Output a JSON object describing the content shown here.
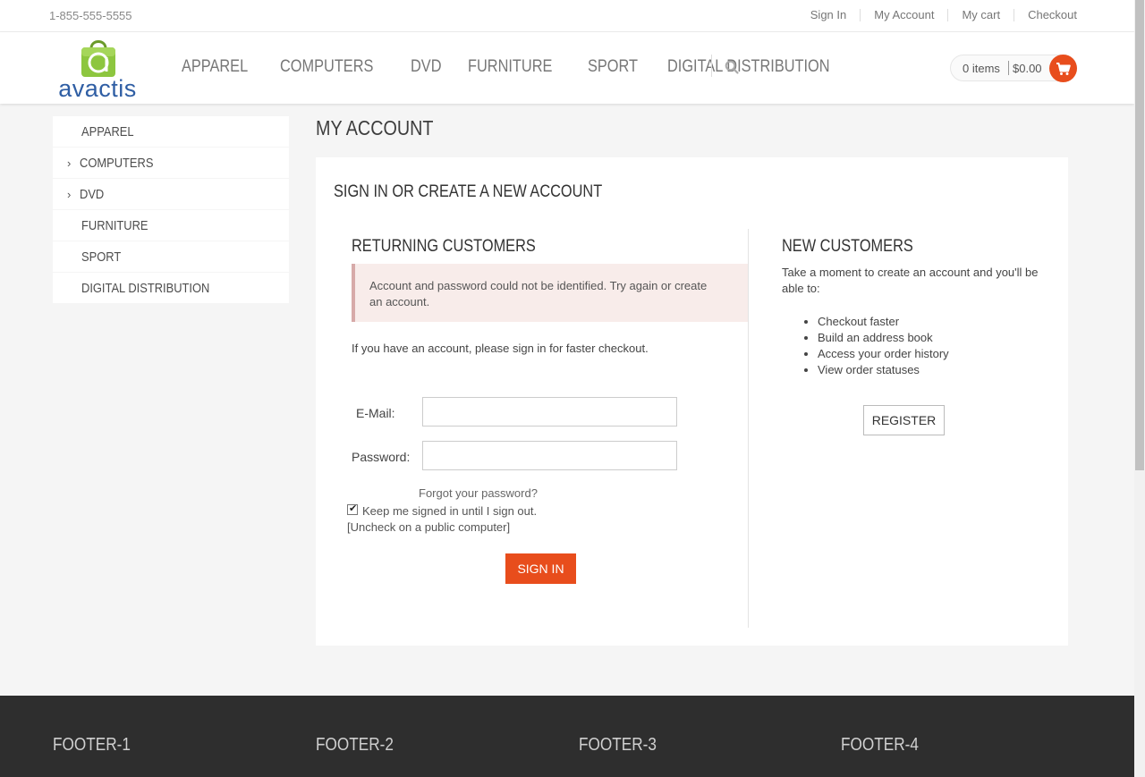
{
  "topbar": {
    "phone": "1-855-555-5555",
    "links": [
      "Sign In",
      "My Account",
      "My cart",
      "Checkout"
    ]
  },
  "header": {
    "logo_text": "avactis",
    "logo_letter": "a",
    "nav": [
      "APPAREL",
      "COMPUTERS",
      "DVD",
      "FURNITURE",
      "SPORT",
      "DIGITAL DISTRIBUTION"
    ],
    "cart": {
      "items": "0 items",
      "total": "$0.00"
    }
  },
  "sidebar": {
    "items": [
      {
        "label": "APPAREL",
        "chevron": ""
      },
      {
        "label": "COMPUTERS",
        "chevron": "›"
      },
      {
        "label": "DVD",
        "chevron": "›"
      },
      {
        "label": "FURNITURE",
        "chevron": ""
      },
      {
        "label": "SPORT",
        "chevron": ""
      },
      {
        "label": "DIGITAL DISTRIBUTION",
        "chevron": ""
      }
    ]
  },
  "main": {
    "page_title": "MY ACCOUNT",
    "card_title": "SIGN IN OR CREATE A NEW ACCOUNT",
    "returning": {
      "heading": "RETURNING CUSTOMERS",
      "error": "Account and password could not be identified. Try again or create an account.",
      "hint": "If you have an account, please sign in for faster checkout.",
      "email_label": "E-Mail:",
      "email_value": "",
      "password_label": "Password:",
      "password_value": "",
      "forgot": "Forgot your password?",
      "keep_signed": "Keep me signed in until I sign out.",
      "keep_signed_checked": true,
      "uncheck_note": "[Uncheck on a public computer]",
      "signin_label": "SIGN IN"
    },
    "new_customers": {
      "heading": "NEW CUSTOMERS",
      "intro": "Take a moment to create an account and you'll be able to:",
      "benefits": [
        "Checkout faster",
        "Build an address book",
        "Access your order history",
        "View order statuses"
      ],
      "register_label": "REGISTER"
    }
  },
  "footer": {
    "headings": [
      "FOOTER-1",
      "FOOTER-2",
      "FOOTER-3",
      "FOOTER-4"
    ]
  },
  "colors": {
    "accent": "#e84d1c",
    "logo_green": "#8dc63f",
    "logo_blue": "#2f5ea4",
    "footer_bg": "#2e2e2e",
    "alert_bg": "#f8ecea"
  },
  "icons": [
    "shopping-bag-logo-icon",
    "search-icon",
    "cart-icon",
    "chevron-right-icon",
    "checkbox-checked-icon"
  ]
}
